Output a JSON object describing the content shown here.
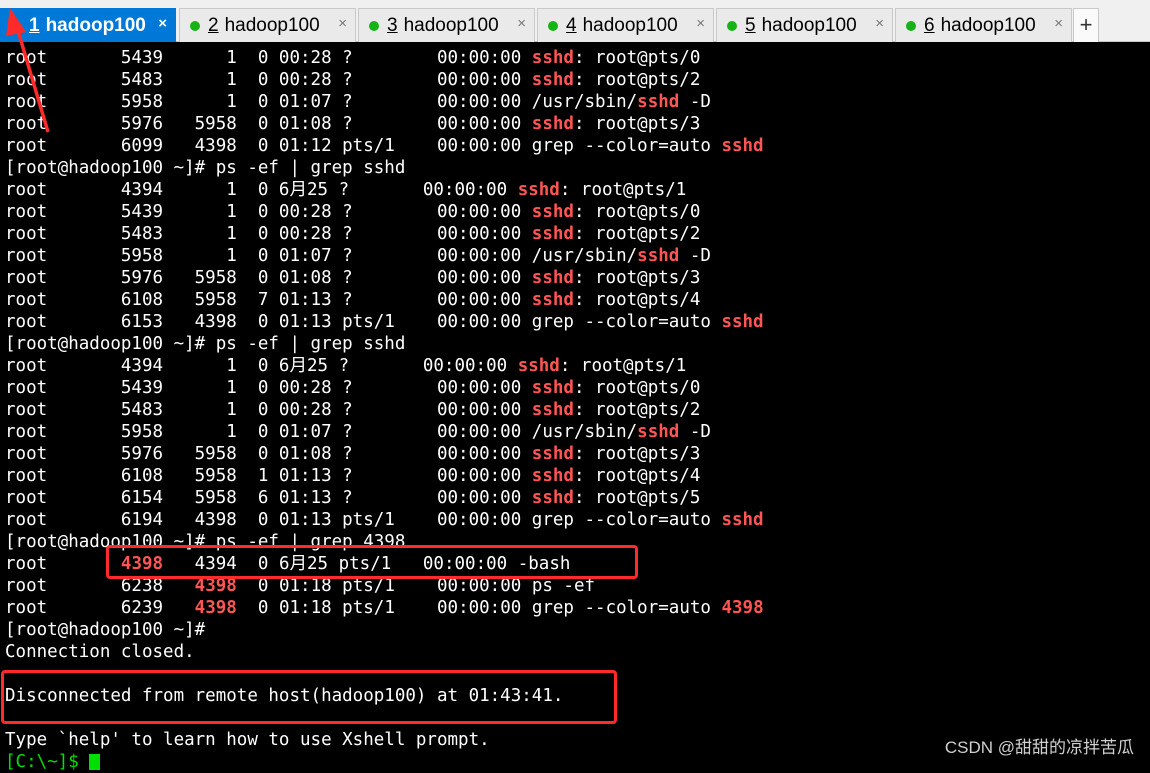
{
  "tabs": [
    {
      "num": "1",
      "label": "hadoop100",
      "status_color": "#ff2a2a",
      "close": "×",
      "active": true
    },
    {
      "num": "2",
      "label": "hadoop100",
      "status_color": "#16b316",
      "close": "×",
      "active": false
    },
    {
      "num": "3",
      "label": "hadoop100",
      "status_color": "#16b316",
      "close": "×",
      "active": false
    },
    {
      "num": "4",
      "label": "hadoop100",
      "status_color": "#16b316",
      "close": "×",
      "active": false
    },
    {
      "num": "5",
      "label": "hadoop100",
      "status_color": "#16b316",
      "close": "×",
      "active": false
    },
    {
      "num": "6",
      "label": "hadoop100",
      "status_color": "#16b316",
      "close": "×",
      "active": false
    }
  ],
  "new_tab": "+",
  "terminal": {
    "lines": [
      [
        "root       5439      1  0 00:28 ?        00:00:00 ",
        {
          "t": "sshd",
          "hl": true
        },
        ": root@pts/0"
      ],
      [
        "root       5483      1  0 00:28 ?        00:00:00 ",
        {
          "t": "sshd",
          "hl": true
        },
        ": root@pts/2"
      ],
      [
        "root       5958      1  0 01:07 ?        00:00:00 /usr/sbin/",
        {
          "t": "sshd",
          "hl": true
        },
        " -D"
      ],
      [
        "root       5976   5958  0 01:08 ?        00:00:00 ",
        {
          "t": "sshd",
          "hl": true
        },
        ": root@pts/3"
      ],
      [
        "root       6099   4398  0 01:12 pts/1    00:00:00 grep --color=auto ",
        {
          "t": "sshd",
          "hl": true
        }
      ],
      [
        "[root@hadoop100 ~]# ps -ef | grep sshd"
      ],
      [
        "root       4394      1  0 6月25 ?       00:00:00 ",
        {
          "t": "sshd",
          "hl": true
        },
        ": root@pts/1"
      ],
      [
        "root       5439      1  0 00:28 ?        00:00:00 ",
        {
          "t": "sshd",
          "hl": true
        },
        ": root@pts/0"
      ],
      [
        "root       5483      1  0 00:28 ?        00:00:00 ",
        {
          "t": "sshd",
          "hl": true
        },
        ": root@pts/2"
      ],
      [
        "root       5958      1  0 01:07 ?        00:00:00 /usr/sbin/",
        {
          "t": "sshd",
          "hl": true
        },
        " -D"
      ],
      [
        "root       5976   5958  0 01:08 ?        00:00:00 ",
        {
          "t": "sshd",
          "hl": true
        },
        ": root@pts/3"
      ],
      [
        "root       6108   5958  7 01:13 ?        00:00:00 ",
        {
          "t": "sshd",
          "hl": true
        },
        ": root@pts/4"
      ],
      [
        "root       6153   4398  0 01:13 pts/1    00:00:00 grep --color=auto ",
        {
          "t": "sshd",
          "hl": true
        }
      ],
      [
        "[root@hadoop100 ~]# ps -ef | grep sshd"
      ],
      [
        "root       4394      1  0 6月25 ?       00:00:00 ",
        {
          "t": "sshd",
          "hl": true
        },
        ": root@pts/1"
      ],
      [
        "root       5439      1  0 00:28 ?        00:00:00 ",
        {
          "t": "sshd",
          "hl": true
        },
        ": root@pts/0"
      ],
      [
        "root       5483      1  0 00:28 ?        00:00:00 ",
        {
          "t": "sshd",
          "hl": true
        },
        ": root@pts/2"
      ],
      [
        "root       5958      1  0 01:07 ?        00:00:00 /usr/sbin/",
        {
          "t": "sshd",
          "hl": true
        },
        " -D"
      ],
      [
        "root       5976   5958  0 01:08 ?        00:00:00 ",
        {
          "t": "sshd",
          "hl": true
        },
        ": root@pts/3"
      ],
      [
        "root       6108   5958  1 01:13 ?        00:00:00 ",
        {
          "t": "sshd",
          "hl": true
        },
        ": root@pts/4"
      ],
      [
        "root       6154   5958  6 01:13 ?        00:00:00 ",
        {
          "t": "sshd",
          "hl": true
        },
        ": root@pts/5"
      ],
      [
        "root       6194   4398  0 01:13 pts/1    00:00:00 grep --color=auto ",
        {
          "t": "sshd",
          "hl": true
        }
      ],
      [
        "[root@hadoop100 ~]# ps -ef | grep 4398"
      ],
      [
        "root       ",
        {
          "t": "4398",
          "hl": true
        },
        "   4394  0 6月25 pts/1   00:00:00 -bash"
      ],
      [
        "root       6238   ",
        {
          "t": "4398",
          "hl": true
        },
        "  0 01:18 pts/1    00:00:00 ps -ef"
      ],
      [
        "root       6239   ",
        {
          "t": "4398",
          "hl": true
        },
        "  0 01:18 pts/1    00:00:00 grep --color=auto ",
        {
          "t": "4398",
          "hl": true
        }
      ],
      [
        "[root@hadoop100 ~]#"
      ],
      [
        "Connection closed."
      ],
      [
        ""
      ],
      [
        "Disconnected from remote host(hadoop100) at 01:43:41."
      ],
      [
        ""
      ],
      [
        "Type `help' to learn how to use Xshell prompt."
      ]
    ],
    "local_prompt": "[C:\\~]$ "
  },
  "watermark": "CSDN @甜甜的凉拌苦瓜",
  "colors": {
    "highlight": "#ff5555",
    "annotation": "#ff2a2a",
    "tab_active": "#0078d7",
    "cursor": "#00e000"
  }
}
